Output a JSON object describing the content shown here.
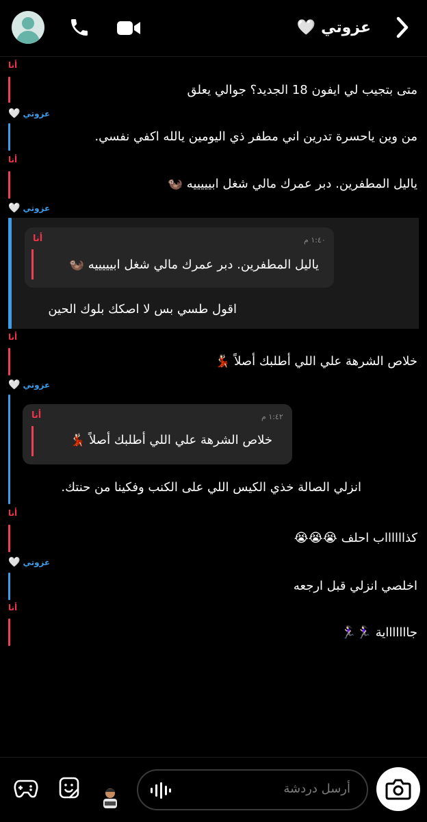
{
  "header": {
    "title": "عزوتي",
    "title_emoji": "🤍",
    "icons": [
      "avatar",
      "phone-icon",
      "video-icon",
      "back-chevron-icon"
    ]
  },
  "labels": {
    "me": "أنا",
    "her": "عزوتي",
    "her_emoji": "🤍"
  },
  "messages": [
    {
      "from": "me",
      "text": "متى بتجيب لي ايفون 18 الجديد؟ جوالي يعلق"
    },
    {
      "from": "her",
      "text": "من وين ياحسرة  تدرين اني مطفر ذي اليومين يالله اكفي نفسي."
    },
    {
      "from": "me",
      "text": "ياليل المطفرين. دبر عمرك مالي شغل ابيييييه 🦦"
    },
    {
      "from": "her",
      "quote": {
        "sender": "أنا",
        "time": "١:٤٠ م",
        "text": "ياليل المطفرين. دبر عمرك مالي شغل ابيييييه 🦦"
      },
      "text": "اقول طسي بس لا اصكك بلوك الحين"
    },
    {
      "from": "me",
      "text": "خلاص الشرهة علي اللي أطلبك أصلاً 💃🏻"
    },
    {
      "from": "her",
      "quote": {
        "sender": "أنا",
        "time": "١:٤٢ م",
        "text": "خلاص الشرهة علي اللي أطلبك أصلاً 💃🏻"
      },
      "text": "انزلي الصالة خذي الكيس اللي على الكنب وفكينا من حنتك."
    },
    {
      "from": "me",
      "text": "كذااااااب احلف 😭😭😭"
    },
    {
      "from": "her",
      "text": "اخلصي انزلي قبل ارجعه"
    },
    {
      "from": "me",
      "text": "جاااااااية 🏃🏻‍♀️🏃🏻‍♀️"
    }
  ],
  "bottom": {
    "placeholder": "أرسل دردشة",
    "icons": [
      "game-controller-icon",
      "sticker-icon",
      "bitmoji-icon",
      "voice-icon",
      "camera-icon"
    ]
  },
  "colors": {
    "me_accent": "#ef3f55",
    "her_accent": "#3f9ce8",
    "background": "#000000",
    "quote_bg": "#1a1a1a"
  }
}
